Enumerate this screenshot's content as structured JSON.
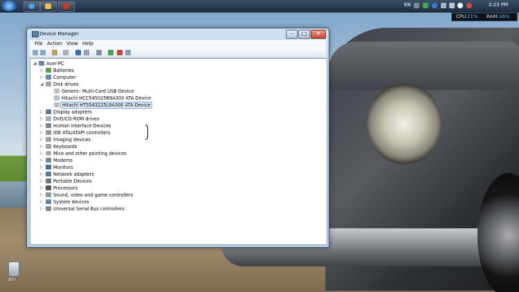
{
  "taskbar": {
    "language": "EN",
    "clock": "2:23 PM",
    "cpu_label": "CPU:",
    "cpu_value": "21%",
    "ram_label": "RAM:",
    "ram_value": "36%"
  },
  "desktop": {
    "recycle_bin_label": "Bin"
  },
  "window": {
    "title": "Device Manager",
    "menu": [
      "File",
      "Action",
      "View",
      "Help"
    ],
    "caption_buttons": {
      "minimize": "–",
      "maximize": "□",
      "close": "✕"
    }
  },
  "tree": {
    "root": "Acer-PC",
    "categories": [
      "Batteries",
      "Computer",
      "Disk drives",
      "Display adapters",
      "DVD/CD-ROM drives",
      "Human Interface Devices",
      "IDE ATA/ATAPI controllers",
      "Imaging devices",
      "Keyboards",
      "Mice and other pointing devices",
      "Modems",
      "Monitors",
      "Network adapters",
      "Portable Devices",
      "Processors",
      "Sound, video and game controllers",
      "System devices",
      "Universal Serial Bus controllers"
    ],
    "disk_drives": [
      "Generic- Multi-Card USB Device",
      "Hitachi HCC545025B9A300 ATA Device",
      "Hitachi HTS543225L9A300 ATA Device"
    ]
  },
  "colors": {
    "accent": "#2d72c4",
    "selection": "#dcecfc",
    "close": "#c9442d"
  }
}
